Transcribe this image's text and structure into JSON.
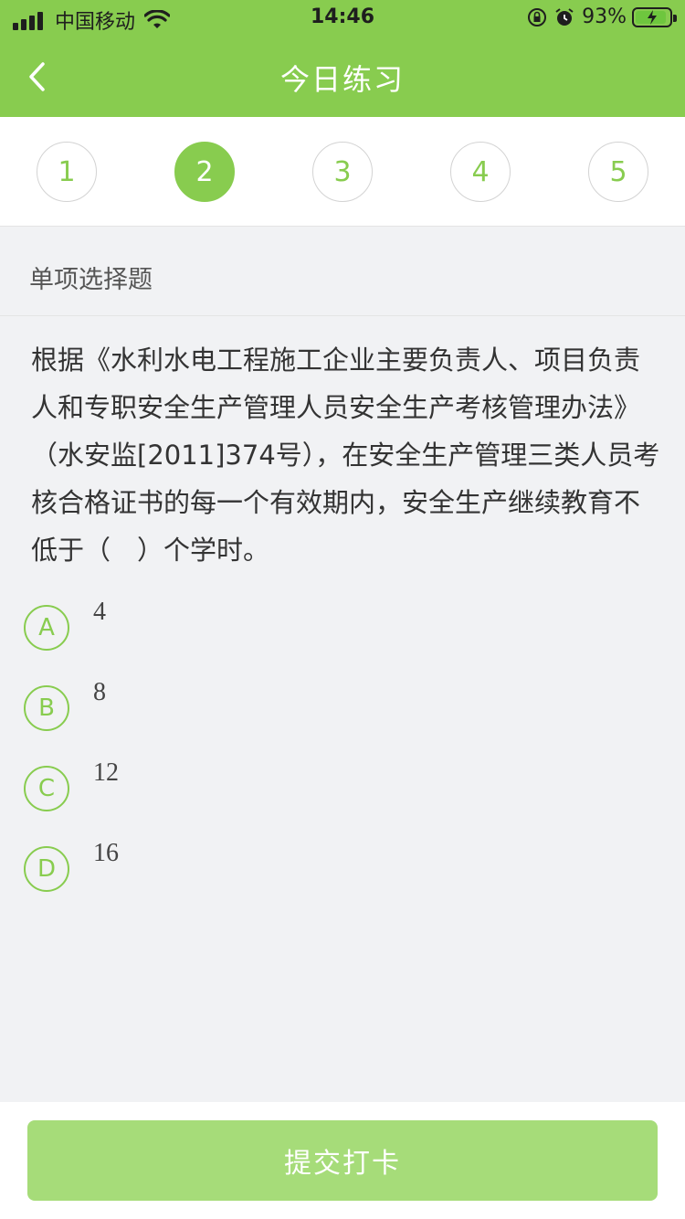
{
  "status_bar": {
    "carrier": "中国移动",
    "time": "14:46",
    "battery_percent": "93%"
  },
  "header": {
    "title": "今日练习"
  },
  "question_nav": {
    "items": [
      "1",
      "2",
      "3",
      "4",
      "5"
    ],
    "active_index": 1
  },
  "question": {
    "type": "单项选择题",
    "text": "根据《水利水电工程施工企业主要负责人、项目负责人和专职安全生产管理人员安全生产考核管理办法》（水安监[2011]374号），在安全生产管理三类人员考核合格证书的每一个有效期内，安全生产继续教育不低于（　）个学时。",
    "options": [
      {
        "letter": "A",
        "text": "4"
      },
      {
        "letter": "B",
        "text": "8"
      },
      {
        "letter": "C",
        "text": "12"
      },
      {
        "letter": "D",
        "text": "16"
      }
    ]
  },
  "footer": {
    "submit_label": "提交打卡"
  },
  "colors": {
    "brand_green": "#88cc4f",
    "button_green": "#a6dc79"
  }
}
